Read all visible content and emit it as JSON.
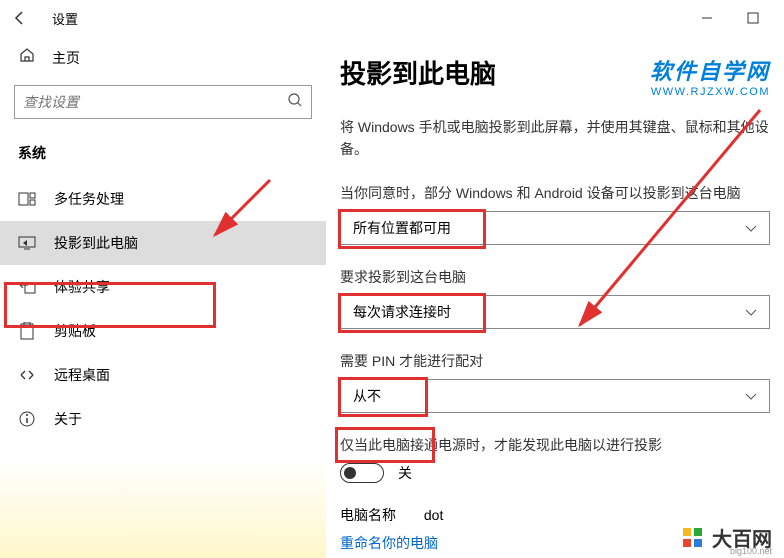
{
  "titlebar": {
    "back": "←",
    "title": "设置"
  },
  "sidebar": {
    "home": "主页",
    "search_placeholder": "查找设置",
    "section": "系统",
    "items": [
      {
        "icon": "multitask",
        "label": "多任务处理"
      },
      {
        "icon": "project",
        "label": "投影到此电脑",
        "active": true
      },
      {
        "icon": "share",
        "label": "体验共享"
      },
      {
        "icon": "clipboard",
        "label": "剪贴板"
      },
      {
        "icon": "remote",
        "label": "远程桌面"
      },
      {
        "icon": "about",
        "label": "关于"
      }
    ]
  },
  "content": {
    "title": "投影到此电脑",
    "brand_cn": "软件自学网",
    "brand_url": "WWW.RJZXW.COM",
    "desc": "将 Windows 手机或电脑投影到此屏幕，并使用其键盘、鼠标和其他设备。",
    "s1_label": "当你同意时，部分 Windows 和 Android 设备可以投影到这台电脑",
    "s1_value": "所有位置都可用",
    "s2_label": "要求投影到这台电脑",
    "s2_value": "每次请求连接时",
    "s3_label": "需要 PIN 才能进行配对",
    "s3_value": "从不",
    "s4_label": "仅当此电脑接通电源时，才能发现此电脑以进行投影",
    "s4_value": "关",
    "name_label": "电脑名称",
    "name_value": "dot",
    "rename_link": "重命名你的电脑"
  },
  "watermark": {
    "text": "大百网",
    "url": "big100.net"
  }
}
